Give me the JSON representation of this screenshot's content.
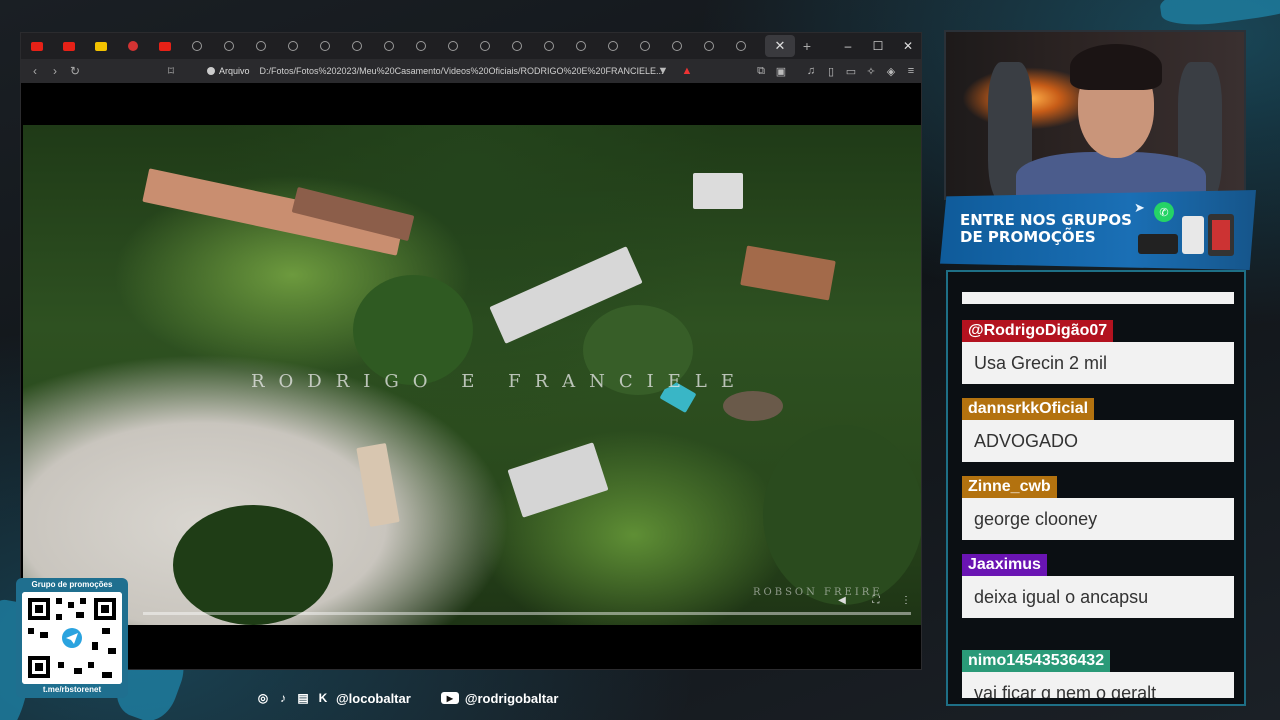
{
  "browser": {
    "tabs": [
      {
        "icon": "youtube-icon",
        "color": "#e62117"
      },
      {
        "icon": "youtube-icon",
        "color": "#e62117"
      },
      {
        "icon": "yellow-app-icon",
        "color": "#f3c200"
      },
      {
        "icon": "red-site-icon",
        "color": "#d33333"
      },
      {
        "icon": "youtube-icon",
        "color": "#e62117"
      },
      {
        "icon": "globe-icon"
      },
      {
        "icon": "globe-icon"
      },
      {
        "icon": "globe-icon"
      },
      {
        "icon": "globe-icon"
      },
      {
        "icon": "globe-icon"
      },
      {
        "icon": "globe-icon"
      },
      {
        "icon": "globe-icon"
      },
      {
        "icon": "globe-icon"
      },
      {
        "icon": "globe-icon"
      },
      {
        "icon": "globe-icon"
      },
      {
        "icon": "globe-icon"
      },
      {
        "icon": "globe-icon"
      },
      {
        "icon": "globe-icon"
      },
      {
        "icon": "globe-icon"
      },
      {
        "icon": "globe-icon"
      },
      {
        "icon": "globe-icon"
      },
      {
        "icon": "globe-icon"
      },
      {
        "icon": "globe-icon"
      }
    ],
    "active_tab_close": "✕",
    "new_tab": "+",
    "window_controls": {
      "minimize": "–",
      "maximize": "☐",
      "close": "✕"
    },
    "url_scheme": "Arquivo",
    "url": "D:/Fotos/Fotos%202023/Meu%20Casamento/Videos%20Oficiais/RODRIGO%20E%20FRANCIELE..."
  },
  "video": {
    "title_overlay": "RODRIGO E FRANCIELE",
    "watermark": "ROBSON FREIRE"
  },
  "promo": {
    "line1": "ENTRE NOS GRUPOS",
    "line2": "DE PROMOÇÕES"
  },
  "chat": {
    "messages": [
      {
        "user": "@RodrigoDigão07",
        "text": "Usa Grecin 2 mil",
        "color": "#b3121f"
      },
      {
        "user": "dannsrkkOficial",
        "text": "ADVOGADO",
        "color": "#b3720f"
      },
      {
        "user": "Zinne_cwb",
        "text": "george clooney",
        "color": "#b3720f"
      },
      {
        "user": "Jaaximus",
        "text": "deixa igual o ancapsu",
        "color": "#6a14b3"
      },
      {
        "user": "nimo14543536432",
        "text": "vai ficar g nem o geralt",
        "color": "#2a9a78"
      }
    ]
  },
  "qr": {
    "title": "Grupo de promoções",
    "url": "t.me/rbstorenet"
  },
  "socials": {
    "handle1": "@locobaltar",
    "handle2": "@rodrigobaltar"
  }
}
